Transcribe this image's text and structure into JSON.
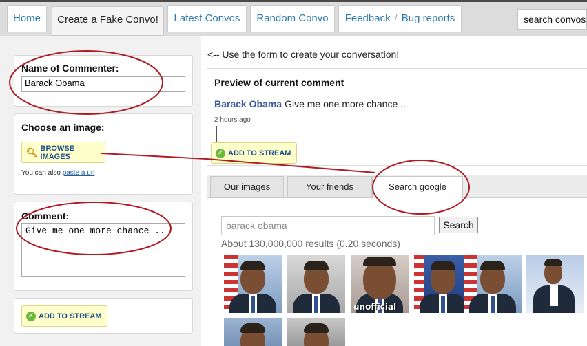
{
  "nav": {
    "home": "Home",
    "create": "Create a Fake Convo!",
    "latest": "Latest Convos",
    "random": "Random Convo",
    "feedback": "Feedback",
    "separator": "/",
    "bug_reports": "Bug reports",
    "search_label": "search convos"
  },
  "form": {
    "commenter_label": "Name of Commenter:",
    "commenter_value": "Barack Obama",
    "image_label": "Choose an image:",
    "browse_button": "BROWSE IMAGES",
    "also_text": "You can also",
    "paste_link": "paste a url",
    "comment_label": "Comment:",
    "comment_value": "Give me one more chance ..",
    "add_button": "ADD TO STREAM"
  },
  "preview": {
    "hint": "<-- Use the form to create your conversation!",
    "title": "Preview of current comment",
    "name": "Barack Obama",
    "comment": "Give me one more chance ..",
    "time": "2 hours ago",
    "add_button": "ADD TO STREAM"
  },
  "image_tabs": {
    "ours": "Our images",
    "friends": "Your friends",
    "google": "Search google"
  },
  "google": {
    "query": "barack obama",
    "search_button": "Search",
    "results": "About 130,000,000 results (0.20 seconds)",
    "thumb3_caption": "unofficial"
  },
  "colors": {
    "annotation": "#b01c24",
    "link": "#2b7bb6",
    "name_blue": "#3b5998",
    "button_yellow": "#ffffcc"
  }
}
